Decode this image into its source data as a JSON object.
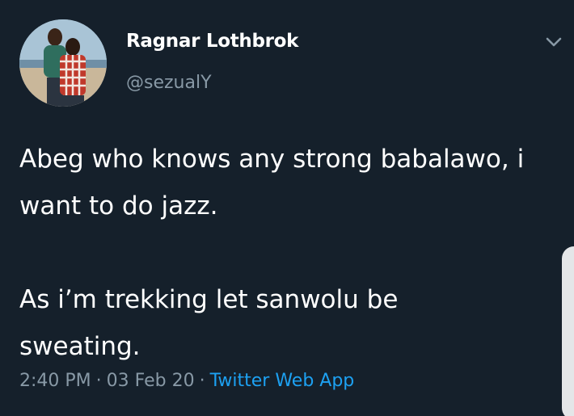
{
  "tweet": {
    "author": {
      "display_name": "Ragnar Lothbrok",
      "handle": "@sezualY"
    },
    "text_paragraphs": [
      "Abeg who knows any strong babalawo, i\nwant to do jazz.",
      "As i’m trekking let sanwolu be\nsweating."
    ],
    "meta": {
      "time": "2:40 PM",
      "separator": "·",
      "date": "03 Feb 20",
      "source": "Twitter Web App"
    }
  },
  "icons": {
    "menu": "chevron-down-icon"
  },
  "colors": {
    "background": "#15202b",
    "primary_text": "#ffffff",
    "secondary_text": "#8899a6",
    "link": "#1da1f2"
  }
}
